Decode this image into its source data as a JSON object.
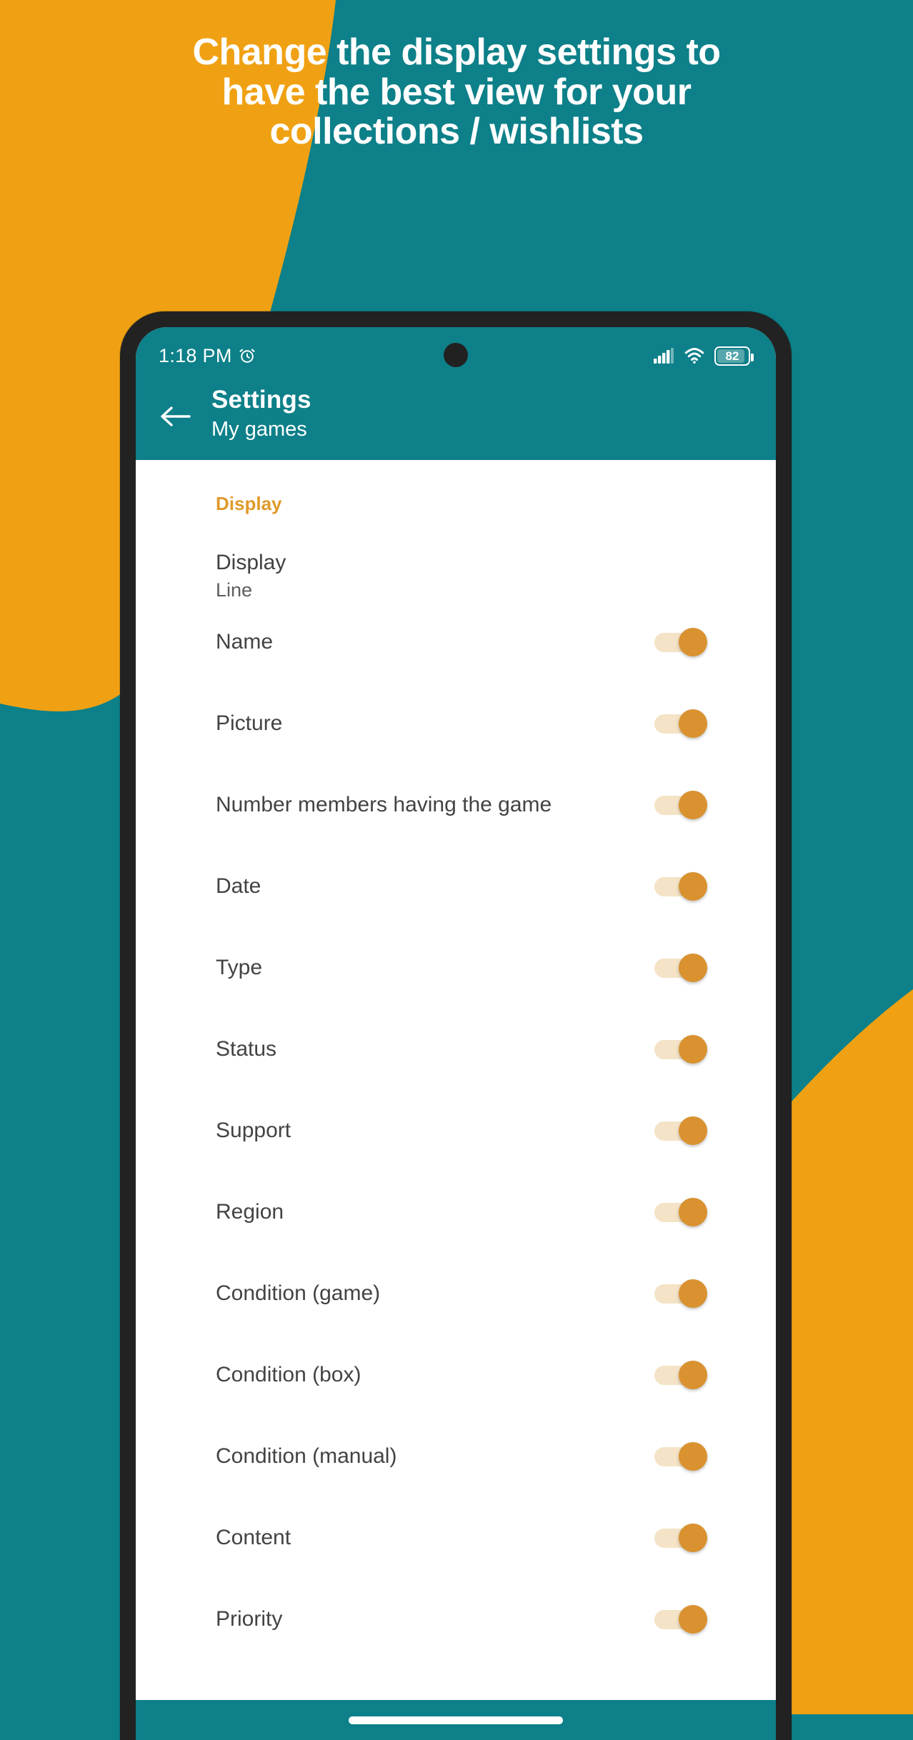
{
  "promo": {
    "headline_lines": [
      "Change the display settings to",
      "have the best view for your",
      "collections / wishlists"
    ],
    "colors": {
      "teal": "#0d8089",
      "orange": "#f0a113",
      "accent_orange": "#e09a2b",
      "switch_thumb": "#d9922f",
      "switch_track": "#f4e3c6",
      "frame": "#222222",
      "text_primary": "#434343",
      "white": "#ffffff"
    }
  },
  "phone": {
    "status_bar": {
      "time": "1:18 PM",
      "alarm_icon": "alarm-clock-icon",
      "signal_icon": "cellular-signal-icon",
      "wifi_icon": "wifi-icon",
      "battery_icon": "battery-icon",
      "battery_level": "82"
    },
    "app_bar": {
      "back_icon": "back-arrow-icon",
      "title": "Settings",
      "subtitle": "My games"
    },
    "settings": {
      "section_header": "Display",
      "display_row": {
        "title": "Display",
        "value": "Line"
      },
      "toggles": [
        {
          "label": "Name",
          "state": "on"
        },
        {
          "label": "Picture",
          "state": "on"
        },
        {
          "label": "Number members having the game",
          "state": "on"
        },
        {
          "label": "Date",
          "state": "on"
        },
        {
          "label": "Type",
          "state": "on"
        },
        {
          "label": "Status",
          "state": "on"
        },
        {
          "label": "Support",
          "state": "on"
        },
        {
          "label": "Region",
          "state": "on"
        },
        {
          "label": "Condition (game)",
          "state": "on"
        },
        {
          "label": "Condition (box)",
          "state": "on"
        },
        {
          "label": "Condition (manual)",
          "state": "on"
        },
        {
          "label": "Content",
          "state": "on"
        },
        {
          "label": "Priority",
          "state": "on"
        }
      ]
    },
    "nav_bar": {
      "home_indicator": "home-indicator-pill"
    }
  }
}
